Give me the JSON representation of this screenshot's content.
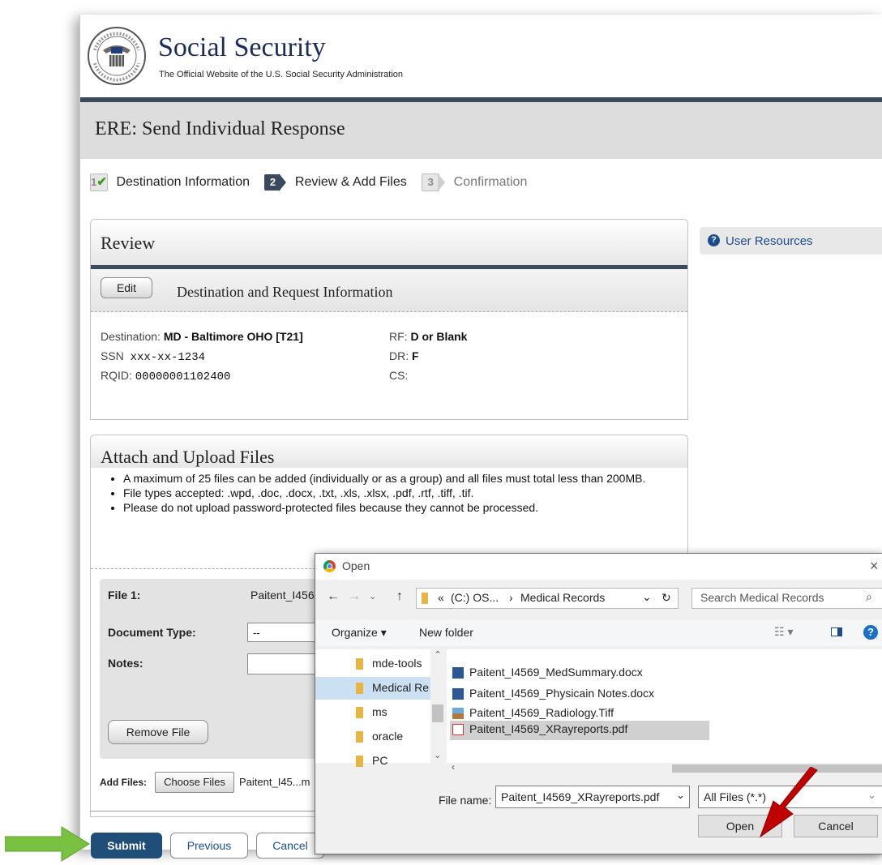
{
  "site": {
    "title": "Social Security",
    "subtitle": "The Official Website of the U.S. Social Security Administration",
    "seal_text": "SOCIAL SECURITY ADMINISTRATION USA"
  },
  "page": {
    "title": "ERE: Send Individual Response"
  },
  "steps": [
    {
      "num": "1",
      "label": "Destination Information",
      "state": "done"
    },
    {
      "num": "2",
      "label": "Review & Add Files",
      "state": "current"
    },
    {
      "num": "3",
      "label": "Confirmation",
      "state": "todo"
    }
  ],
  "resources": {
    "label": "User Resources"
  },
  "review": {
    "title": "Review",
    "edit_label": "Edit",
    "section_title": "Destination and Request Information",
    "destination_label": "Destination:",
    "destination_value": "MD - Baltimore OHO [T21]",
    "ssn_label": "SSN",
    "ssn_value": "xxx-xx-1234",
    "rqid_label": "RQID:",
    "rqid_value": "00000001102400",
    "rf_label": "RF:",
    "rf_value": "D or Blank",
    "dr_label": "DR:",
    "dr_value": "F",
    "cs_label": "CS:"
  },
  "attach": {
    "title": "Attach and Upload Files",
    "rules": [
      "A maximum of 25 files can be added (individually or as a group) and all files must total less than 200MB.",
      "File types accepted: .wpd, .doc, .docx, .txt, .xls, .xlsx, .pdf, .rtf, .tiff, .tif.",
      "Please do not upload password-protected files because they cannot be processed."
    ],
    "file1_label": "File 1:",
    "file1_value": "Paitent_I456",
    "doctype_label": "Document Type:",
    "doctype_value": "--",
    "notes_label": "Notes:",
    "remove_label": "Remove File",
    "add_files_label": "Add Files:",
    "choose_label": "Choose Files",
    "chosen_text": "Paitent_I45...m"
  },
  "actions": {
    "submit": "Submit",
    "previous": "Previous",
    "cancel": "Cancel"
  },
  "dialog": {
    "title": "Open",
    "close": "×",
    "path_prefix": "«",
    "path_drive": "(C:) OS...",
    "path_sep": "›",
    "path_folder": "Medical Records",
    "search_placeholder": "Search Medical Records",
    "organize": "Organize ▾",
    "new_folder": "New folder",
    "nav_items": [
      "mde-tools",
      "Medical Re",
      "ms",
      "oracle",
      "PC"
    ],
    "files": [
      {
        "name": "Paitent_I4569_MedSummary.docx",
        "type": "docx"
      },
      {
        "name": "Paitent_I4569_Physicain Notes.docx",
        "type": "docx"
      },
      {
        "name": "Paitent_I4569_Radiology.Tiff",
        "type": "tiff"
      },
      {
        "name": "Paitent_I4569_XRayreports.pdf",
        "type": "pdf"
      }
    ],
    "selected_file_index": 3,
    "file_name_label": "File name:",
    "file_name_value": "Paitent_I4569_XRayreports.pdf",
    "file_type_value": "All Files (*.*)",
    "open_label": "Open",
    "cancel_label": "Cancel"
  },
  "colors": {
    "submit_bg": "#1f4e79",
    "arrow_green": "#7ac142",
    "arrow_red": "#c00000",
    "link_blue": "#1a4d8f"
  }
}
